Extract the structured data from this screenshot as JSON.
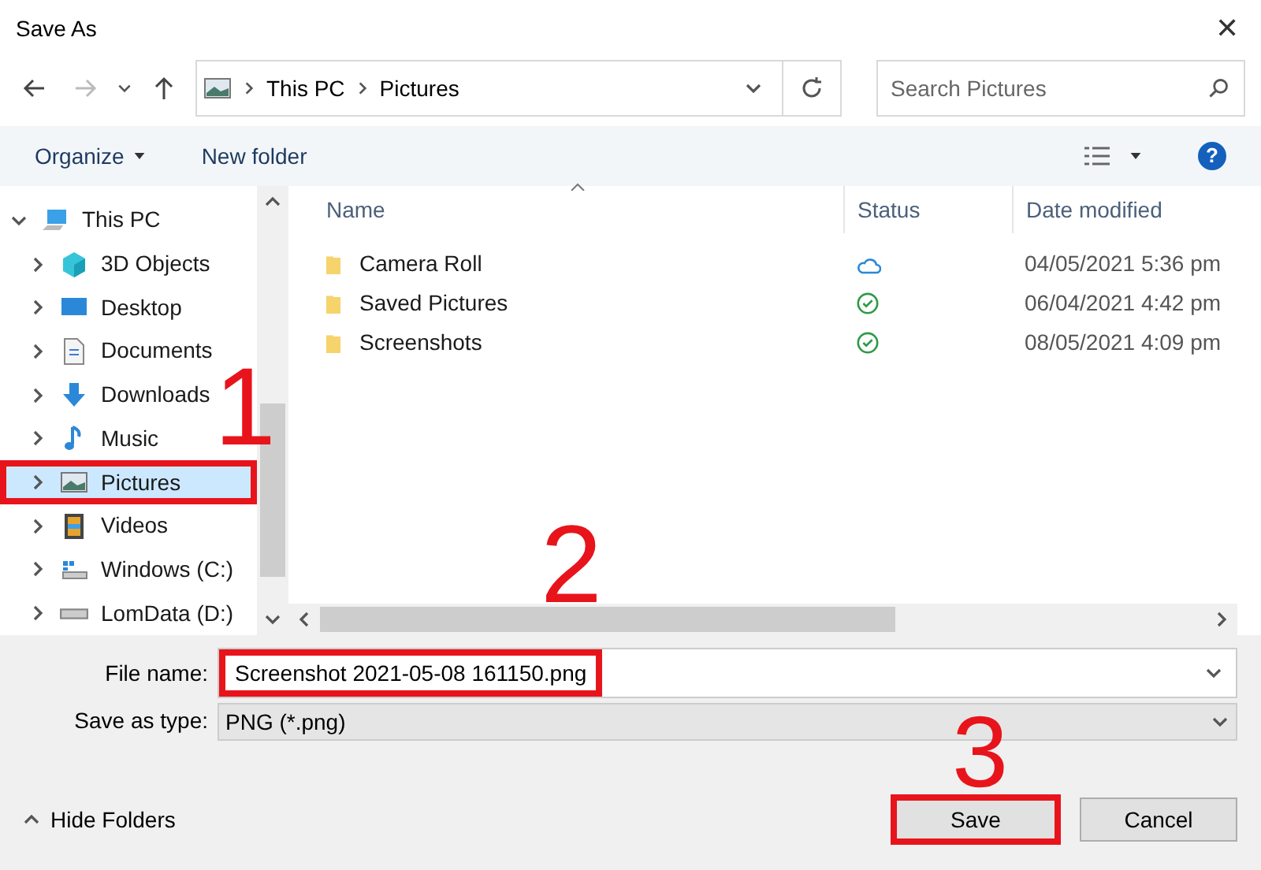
{
  "window": {
    "title": "Save As",
    "close": "✕"
  },
  "address": {
    "path": [
      "This PC",
      "Pictures"
    ]
  },
  "search": {
    "placeholder": "Search Pictures"
  },
  "toolbar": {
    "organize": "Organize",
    "new_folder": "New folder",
    "help": "?"
  },
  "sidebar": {
    "items": [
      {
        "label": "This PC",
        "kind": "computer",
        "expanded": true,
        "selected": false,
        "highlighted": false,
        "children": [
          {
            "label": "3D Objects",
            "kind": "cube",
            "expanded": false,
            "selected": false,
            "highlighted": false
          },
          {
            "label": "Desktop",
            "kind": "desktop",
            "expanded": false,
            "selected": false,
            "highlighted": false
          },
          {
            "label": "Documents",
            "kind": "document",
            "expanded": false,
            "selected": false,
            "highlighted": false
          },
          {
            "label": "Downloads",
            "kind": "download",
            "expanded": false,
            "selected": false,
            "highlighted": false
          },
          {
            "label": "Music",
            "kind": "music",
            "expanded": false,
            "selected": false,
            "highlighted": false
          },
          {
            "label": "Pictures",
            "kind": "pictures",
            "expanded": false,
            "selected": true,
            "highlighted": true
          },
          {
            "label": "Videos",
            "kind": "videos",
            "expanded": false,
            "selected": false,
            "highlighted": false
          },
          {
            "label": "Windows (C:)",
            "kind": "systemdrive",
            "expanded": false,
            "selected": false,
            "highlighted": false
          },
          {
            "label": "LomData (D:)",
            "kind": "drive",
            "expanded": false,
            "selected": false,
            "highlighted": false
          }
        ]
      }
    ]
  },
  "table": {
    "columns": [
      "Name",
      "Status",
      "Date modified"
    ],
    "rows": [
      {
        "name": "Camera Roll",
        "kind": "cloud",
        "date": "04/05/2021 5:36 pm"
      },
      {
        "name": "Saved Pictures",
        "kind": "synced",
        "date": "06/04/2021 4:42 pm"
      },
      {
        "name": "Screenshots",
        "kind": "synced",
        "date": "08/05/2021 4:09 pm"
      }
    ]
  },
  "file_name": {
    "label": "File name:",
    "value": "Screenshot 2021-05-08 161150.png",
    "highlighted": true
  },
  "save_as_type": {
    "label": "Save as type:",
    "value": "PNG (*.png)"
  },
  "hide_folders": "Hide Folders",
  "buttons": [
    {
      "label": "Save",
      "highlighted": true
    },
    {
      "label": "Cancel",
      "highlighted": false
    }
  ],
  "annotations": [
    "1",
    "2",
    "3"
  ]
}
